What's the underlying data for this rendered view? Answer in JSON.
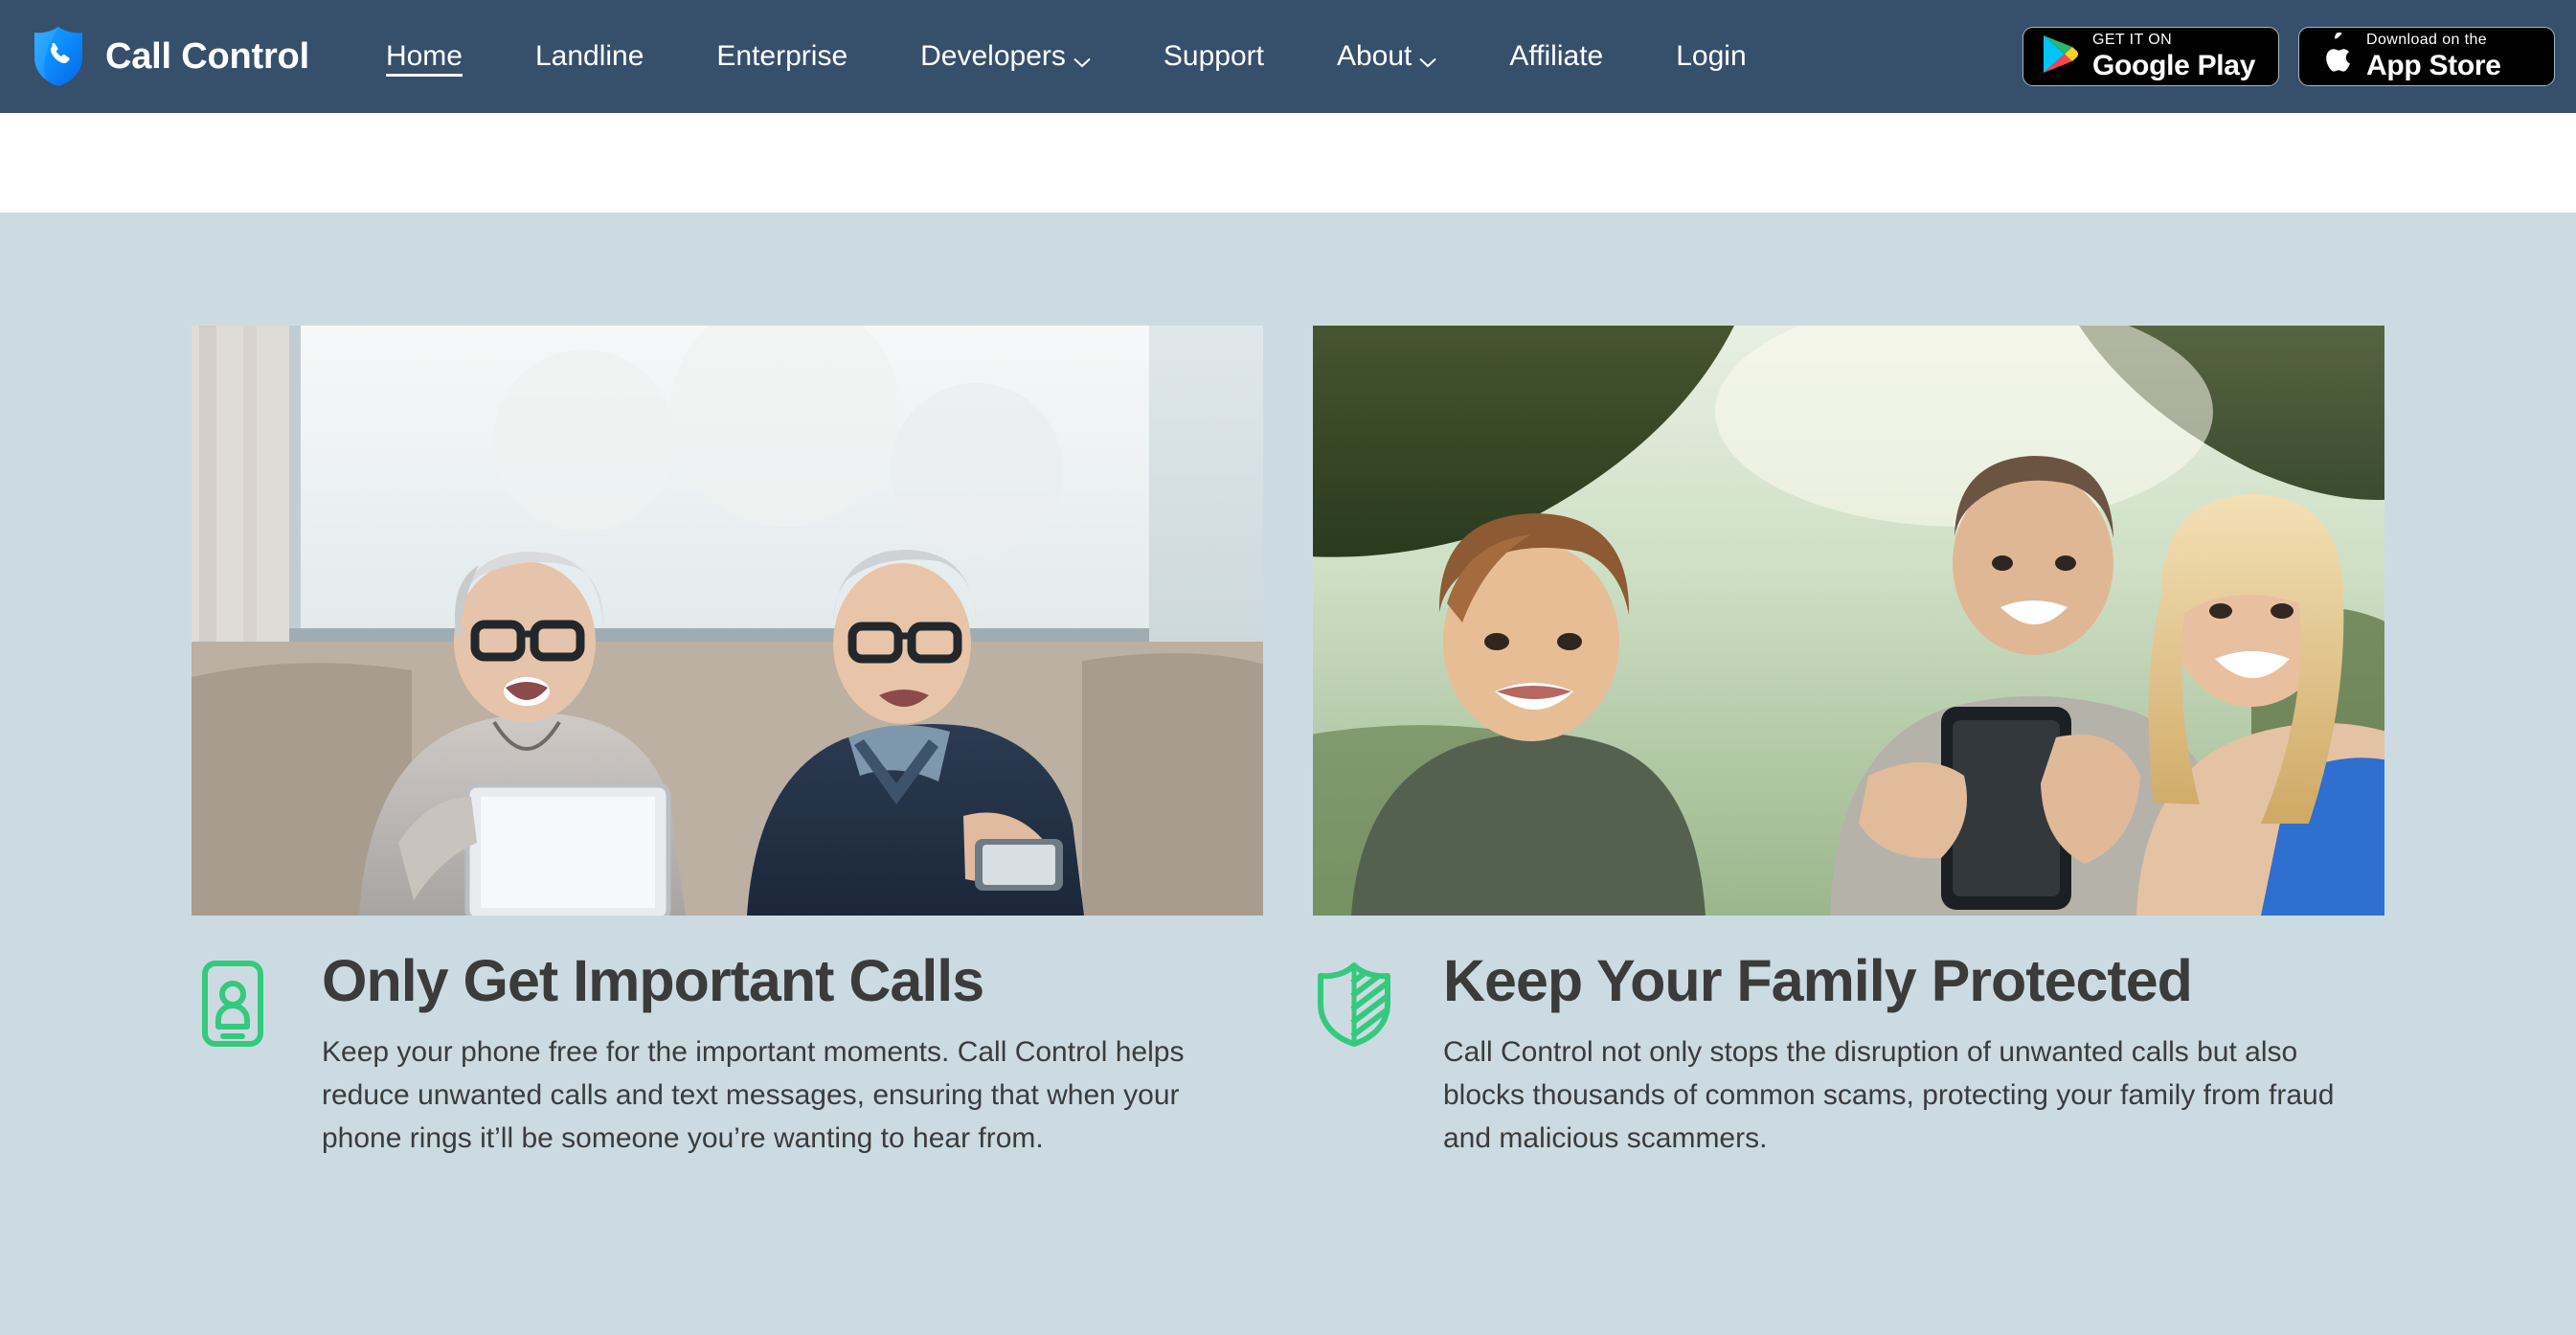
{
  "brand": {
    "name": "Call Control",
    "logo_icon": "shield-phone-logo",
    "logo_colors": {
      "shield_light": "#1e9bff",
      "shield_dark": "#0a6fe8"
    }
  },
  "nav": {
    "background_color": "#364f6b",
    "items": [
      {
        "label": "Home",
        "has_dropdown": false,
        "active": true
      },
      {
        "label": "Landline",
        "has_dropdown": false,
        "active": false
      },
      {
        "label": "Enterprise",
        "has_dropdown": false,
        "active": false
      },
      {
        "label": "Developers",
        "has_dropdown": true,
        "active": false
      },
      {
        "label": "Support",
        "has_dropdown": false,
        "active": false
      },
      {
        "label": "About",
        "has_dropdown": true,
        "active": false
      },
      {
        "label": "Affiliate",
        "has_dropdown": false,
        "active": false
      },
      {
        "label": "Login",
        "has_dropdown": false,
        "active": false
      }
    ]
  },
  "store_badges": [
    {
      "icon": "google-play-icon",
      "small_label": "GET IT ON",
      "big_label": "Google Play"
    },
    {
      "icon": "apple-logo-icon",
      "small_label": "Download on the",
      "big_label": "App Store"
    }
  ],
  "features": {
    "background_color": "#ccdbe2",
    "accent_color": "#35c97e",
    "items": [
      {
        "photo_alt": "Smiling senior couple sitting on a couch with a tablet and a smartphone",
        "icon": "phone-person-icon",
        "title": "Only Get Important Calls",
        "description": "Keep your phone free for the important moments. Call Control helps reduce unwanted calls and text messages, ensuring that when your phone rings it’ll be someone you’re wanting to hear from."
      },
      {
        "photo_alt": "Family with a boy, man and woman outdoors laughing while looking at a smartphone",
        "icon": "shield-striped-icon",
        "title": "Keep Your Family Protected",
        "description": "Call Control not only stops the disruption of unwanted calls but also blocks thousands of common scams, protecting your family from fraud and malicious scammers."
      }
    ]
  }
}
